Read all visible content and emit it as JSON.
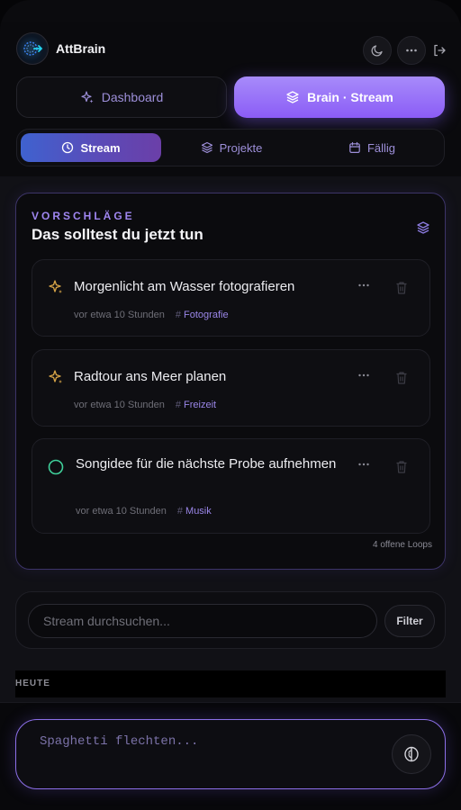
{
  "app": {
    "name": "AttBrain"
  },
  "header": {
    "icons": [
      "moon-icon",
      "more-horizontal-icon",
      "logout-icon"
    ]
  },
  "modes": [
    {
      "label": "Dashboard",
      "icon": "sparkles-icon",
      "active": false
    },
    {
      "label": "Brain · Stream",
      "icon": "layers-icon",
      "active": true
    }
  ],
  "subtabs": [
    {
      "label": "Stream",
      "icon": "clock-icon",
      "active": true
    },
    {
      "label": "Projekte",
      "icon": "layers-icon",
      "active": false
    },
    {
      "label": "Fällig",
      "icon": "calendar-icon",
      "active": false
    }
  ],
  "suggestions": {
    "eyebrow": "VORSCHLÄGE",
    "title": "Das solltest du jetzt tun",
    "items": [
      {
        "title": "Morgenlicht am Wasser fotografieren",
        "time": "vor etwa 10 Stunden",
        "tag": "Fotografie",
        "icon": "sparkles-icon"
      },
      {
        "title": "Radtour ans Meer planen",
        "time": "vor etwa 10 Stunden",
        "tag": "Freizeit",
        "icon": "sparkles-icon"
      },
      {
        "title": "Songidee für die nächste Probe aufnehmen",
        "time": "vor etwa 10 Stunden",
        "tag": "Musik",
        "icon": "circle-icon"
      }
    ],
    "open_loops": "4 offene Loops"
  },
  "search": {
    "placeholder": "Stream durchsuchen...",
    "value": "",
    "filter_label": "Filter"
  },
  "sections": {
    "today": "HEUTE"
  },
  "composer": {
    "placeholder": "Spaghetti flechten...",
    "value": ""
  },
  "colors": {
    "accent": "#8b5cf6",
    "accent_light": "#a78bfa",
    "tab_active_start": "#3f62cf",
    "tab_active_end": "#6b3fa8",
    "sparkle": "#d6a447",
    "circle_green": "#3fcf9a",
    "tag": "#9a86e8"
  }
}
